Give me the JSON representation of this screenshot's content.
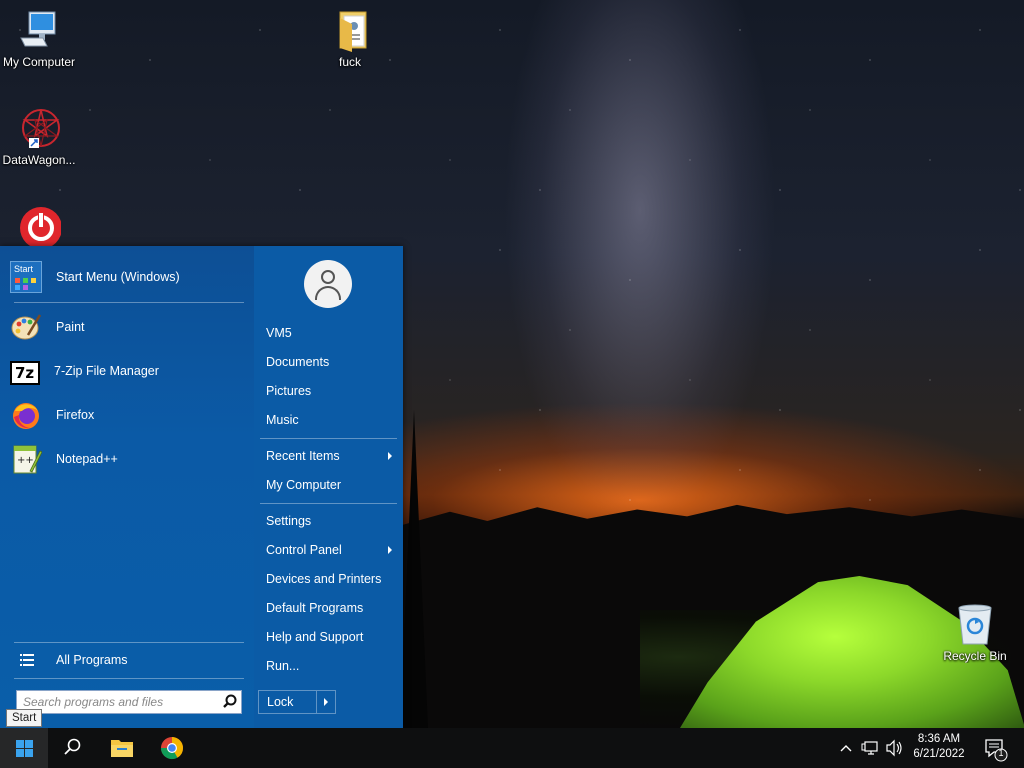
{
  "desktop": {
    "icons": [
      {
        "label": "My Computer"
      },
      {
        "label": "DataWagon..."
      },
      {
        "label": "fuck"
      },
      {
        "label": "Recycle Bin"
      }
    ]
  },
  "start_menu": {
    "pinned": {
      "label": "Start Menu (Windows)",
      "icon_text": "Start"
    },
    "programs": [
      {
        "label": "Paint",
        "icon": "paint-icon"
      },
      {
        "label": "7-Zip File Manager",
        "icon": "7zip-icon",
        "icon_text": "7z"
      },
      {
        "label": "Firefox",
        "icon": "firefox-icon"
      },
      {
        "label": "Notepad++",
        "icon": "notepadpp-icon"
      }
    ],
    "all_programs": "All Programs",
    "search": {
      "placeholder": "Search programs and files",
      "value": ""
    },
    "user": {
      "name": "VM5"
    },
    "right_items": [
      {
        "label": "Documents"
      },
      {
        "label": "Pictures"
      },
      {
        "label": "Music"
      },
      {
        "label": "Recent Items",
        "has_submenu": true
      },
      {
        "label": "My Computer"
      },
      {
        "label": "Settings"
      },
      {
        "label": "Control Panel",
        "has_submenu": true
      },
      {
        "label": "Devices and Printers"
      },
      {
        "label": "Default Programs"
      },
      {
        "label": "Help and Support"
      },
      {
        "label": "Run..."
      }
    ],
    "lock": "Lock"
  },
  "tooltip": "Start",
  "taskbar": {
    "clock_time": "8:36 AM",
    "clock_date": "6/21/2022",
    "notification_count": "1",
    "pinned": [
      "search-icon",
      "file-explorer-icon",
      "chrome-icon"
    ]
  },
  "colors": {
    "menu_blue": "#0b57a0",
    "taskbar": "#0e0f10",
    "accent": "#3aa3ee"
  }
}
